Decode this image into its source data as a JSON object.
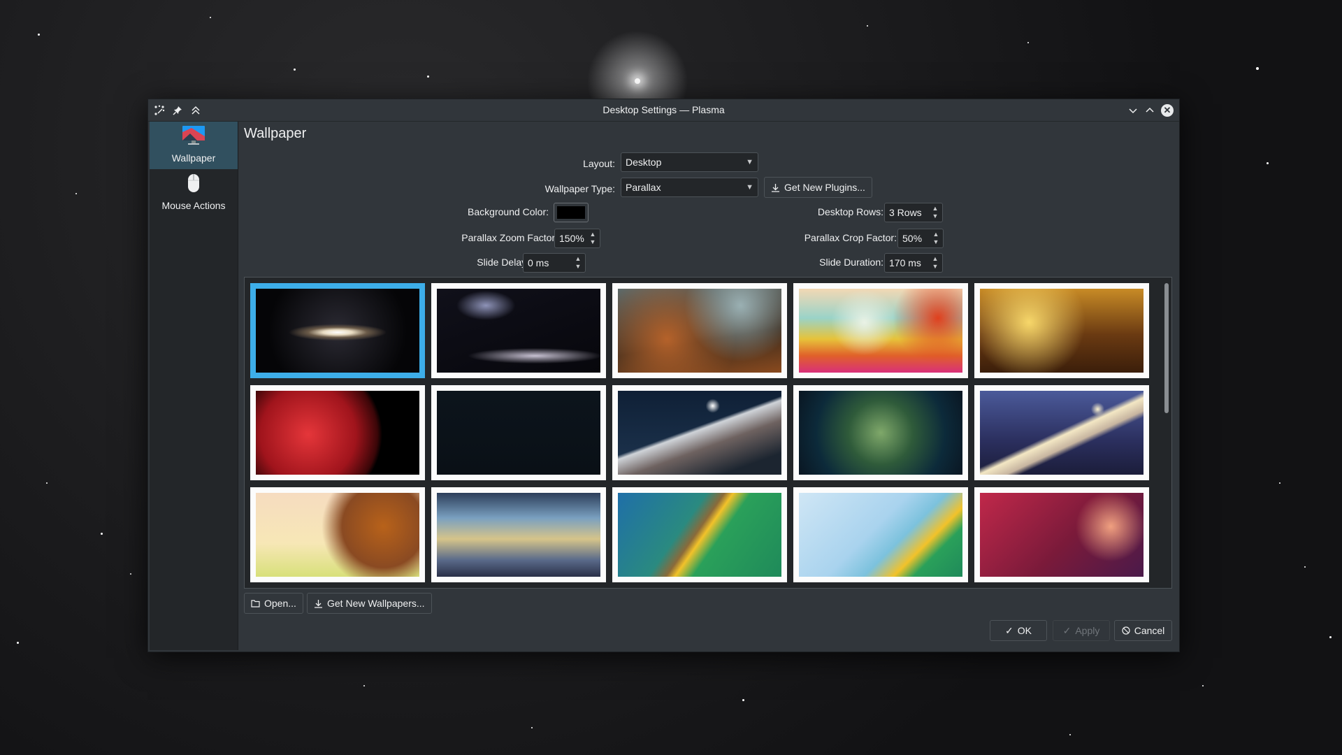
{
  "window": {
    "title": "Desktop Settings — Plasma"
  },
  "sidebar": {
    "items": [
      {
        "label": "Wallpaper",
        "icon": "wallpaper-icon",
        "active": true
      },
      {
        "label": "Mouse Actions",
        "icon": "mouse-icon",
        "active": false
      }
    ]
  },
  "main": {
    "title": "Wallpaper",
    "layout": {
      "label": "Layout:",
      "value": "Desktop"
    },
    "wallpaper_type": {
      "label": "Wallpaper Type:",
      "value": "Parallax",
      "get_plugins_label": "Get New Plugins..."
    },
    "background_color": {
      "label": "Background Color:",
      "value": "#000000"
    },
    "desktop_rows": {
      "label": "Desktop Rows:",
      "value": "3 Rows"
    },
    "zoom_factor": {
      "label": "Parallax Zoom Factor:",
      "value": "150%"
    },
    "crop_factor": {
      "label": "Parallax Crop Factor:",
      "value": "50%"
    },
    "slide_delay": {
      "label": "Slide Delay:",
      "value": "0 ms"
    },
    "slide_duration": {
      "label": "Slide Duration:",
      "value": "170 ms"
    },
    "wallpapers": [
      {
        "name": "sombrero-galaxy",
        "selected": true
      },
      {
        "name": "spiral-galaxy",
        "selected": false
      },
      {
        "name": "nebula-clouds",
        "selected": false
      },
      {
        "name": "colorful-landscape",
        "selected": false
      },
      {
        "name": "golden-ships",
        "selected": false
      },
      {
        "name": "red-moon",
        "selected": false
      },
      {
        "name": "dark-blank",
        "selected": false
      },
      {
        "name": "snowy-mountain",
        "selected": false
      },
      {
        "name": "fractal-pattern",
        "selected": false
      },
      {
        "name": "night-mountain",
        "selected": false
      },
      {
        "name": "autumn-tree",
        "selected": false
      },
      {
        "name": "frozen-lake",
        "selected": false
      },
      {
        "name": "green-abstract",
        "selected": false
      },
      {
        "name": "ice-abstract",
        "selected": false
      },
      {
        "name": "red-hexagons",
        "selected": false
      }
    ],
    "open_label": "Open...",
    "get_wallpapers_label": "Get New Wallpapers..."
  },
  "footer": {
    "ok_label": "OK",
    "apply_label": "Apply",
    "cancel_label": "Cancel"
  },
  "colors": {
    "accent": "#3daee9",
    "window_bg": "#31363b",
    "sidebar_bg": "#232629",
    "sidebar_active": "#31505f"
  }
}
